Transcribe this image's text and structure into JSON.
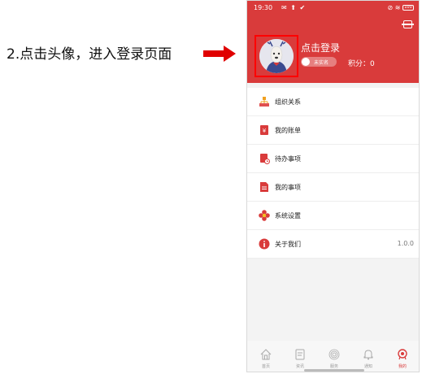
{
  "instruction": "2.点击头像，进入登录页面",
  "status_bar": {
    "time": "19:30",
    "left_icons": "✉ ⬆ ✔",
    "right_icons": "⊘ ≋",
    "battery": "100"
  },
  "profile": {
    "login_text": "点击登录",
    "cert_label": "未实名",
    "points_label": "积分：0"
  },
  "menu": [
    {
      "label": "组织关系",
      "icon": "org-chart-icon"
    },
    {
      "label": "我的账单",
      "icon": "bill-icon"
    },
    {
      "label": "待办事项",
      "icon": "todo-icon"
    },
    {
      "label": "我的事项",
      "icon": "document-icon"
    },
    {
      "label": "系统设置",
      "icon": "settings-flower-icon"
    },
    {
      "label": "关于我们",
      "icon": "info-icon",
      "value": "1.0.0"
    }
  ],
  "tabs": [
    {
      "label": "首页",
      "icon": "home-icon"
    },
    {
      "label": "资讯",
      "icon": "news-icon"
    },
    {
      "label": "服务",
      "icon": "fingerprint-icon"
    },
    {
      "label": "通知",
      "icon": "bell-icon"
    },
    {
      "label": "我的",
      "icon": "profile-medal-icon",
      "active": true
    }
  ],
  "colors": {
    "brand_red": "#d93b3b",
    "highlight_box": "#ff0000",
    "active_tab": "#d93b3b"
  }
}
